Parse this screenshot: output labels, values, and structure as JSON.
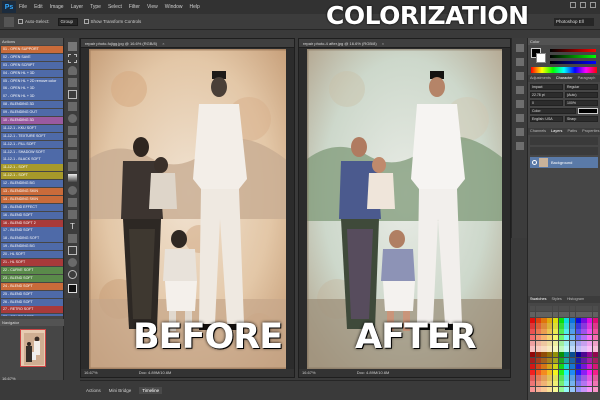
{
  "app": {
    "logo": "Ps",
    "overlay_title": "COLORIZATION"
  },
  "menu": [
    "File",
    "Edit",
    "Image",
    "Layer",
    "Type",
    "Select",
    "Filter",
    "View",
    "Window",
    "Help"
  ],
  "options_bar": {
    "auto_select_label": "Auto-Select:",
    "auto_select_value": "Group",
    "show_transform_label": "Show Transform Controls",
    "workspace": "Photoshop Ell"
  },
  "panels": {
    "actions_title": "Actions",
    "navigator_title": "Navigator",
    "navigator_zoom": "16.67%",
    "colors_title": "Color",
    "adjustments_tabs": [
      "Adjustments",
      "Character",
      "Paragraph"
    ],
    "layers_tabs": [
      "Channels",
      "Layers",
      "Paths",
      "Properties"
    ],
    "layer_name": "Background",
    "swatches_tabs": [
      "Swatches",
      "Styles",
      "Histogram"
    ],
    "char_font": "Impact",
    "char_style": "Regular",
    "char_size": "22.78 pt",
    "char_leading": "(Auto)",
    "char_tracking": "0",
    "char_scale": "100%",
    "char_color_label": "Color:",
    "char_lang": "English: USA",
    "char_aa": "Sharp"
  },
  "actions": [
    {
      "label": "01 - OPEN SUPPORT",
      "color": "#c96b3a"
    },
    {
      "label": "02 - OPEN SAVE",
      "color": "#4e6aa8"
    },
    {
      "label": "03 - OPEN SCRIPT",
      "color": "#4e6aa8"
    },
    {
      "label": "04 - OPEN HL + 3D",
      "color": "#4e6aa8"
    },
    {
      "label": "05 - OPEN HL + 2D remove color",
      "color": "#4e6aa8"
    },
    {
      "label": "06 - OPEN HL + 3D",
      "color": "#4e6aa8"
    },
    {
      "label": "07 - OPEN HL + 3D",
      "color": "#4e6aa8"
    },
    {
      "label": "08 - BLENDING 3D",
      "color": "#4e6aa8"
    },
    {
      "label": "09 - BLENDING OUT",
      "color": "#4e6aa8"
    },
    {
      "label": "10 - BLENDING 3D",
      "color": "#9a5aa0"
    },
    {
      "label": "11-12-1 - KKU SOFT",
      "color": "#4e6aa8"
    },
    {
      "label": "11-12-1 - TEXTURE SOFT",
      "color": "#4e6aa8"
    },
    {
      "label": "11-12-1 - FILL SOFT",
      "color": "#4e6aa8"
    },
    {
      "label": "11-12-1 - SHADOW SOFT",
      "color": "#4e6aa8"
    },
    {
      "label": "11-12-1 - BLACK SOFT",
      "color": "#4e6aa8"
    },
    {
      "label": "11-12-1 - SOFT",
      "color": "#a79a2a"
    },
    {
      "label": "11-12-1 - SOFT",
      "color": "#a79a2a"
    },
    {
      "label": "12 - BLENDING BG",
      "color": "#4e6aa8"
    },
    {
      "label": "13 - BLENDING SKIN",
      "color": "#c96b3a"
    },
    {
      "label": "14 - BLENDING SKIN",
      "color": "#c96b3a"
    },
    {
      "label": "15 - BLEND EFFECT",
      "color": "#4e6aa8"
    },
    {
      "label": "16 - BLEND SOFT",
      "color": "#4e6aa8"
    },
    {
      "label": "16 - BLEND SOFT 2",
      "color": "#a83a3a"
    },
    {
      "label": "17 - BLEND SOFT",
      "color": "#4e6aa8"
    },
    {
      "label": "18 - BLENDING SOFT",
      "color": "#4e6aa8"
    },
    {
      "label": "19 - BLENDING BG",
      "color": "#4e6aa8"
    },
    {
      "label": "20 - HL SOFT",
      "color": "#4e6aa8"
    },
    {
      "label": "21 - HL SOFT",
      "color": "#a83a3a"
    },
    {
      "label": "22 - CURVE SOFT",
      "color": "#5a8a4a"
    },
    {
      "label": "23 - BLEND SOFT",
      "color": "#5a8a4a"
    },
    {
      "label": "24 - BLEND SOFT",
      "color": "#c96b3a"
    },
    {
      "label": "25 - BLEND SOFT",
      "color": "#4e6aa8"
    },
    {
      "label": "26 - BLEND SOFT",
      "color": "#4e6aa8"
    },
    {
      "label": "27 - RETRO SOFT",
      "color": "#a83a3a"
    },
    {
      "label": "28 - COLOR SOFT",
      "color": "#4e6aa8"
    },
    {
      "label": "29 - COLOR 14 SOFT 3.0",
      "color": "#4e6aa8"
    },
    {
      "label": "30 - COLOR 14 SOFT 3.0 color remove",
      "color": "#4e6aa8"
    },
    {
      "label": "31 - COLOR 14 SOFT",
      "color": "#4e6aa8"
    },
    {
      "label": "32 - COLOR 14 SOFT",
      "color": "#4e6aa8"
    },
    {
      "label": "33 - COLOR 14 SOFT",
      "color": "#4e6aa8"
    },
    {
      "label": "34 - COLOR SOFT 3.0",
      "color": "#4e6aa8"
    },
    {
      "label": "35 - COLOR SOFT 3.0 sample texture",
      "color": "#4e6aa8"
    },
    {
      "label": "36 - COLOR SOFT",
      "color": "#a79a2a"
    },
    {
      "label": "jacak (casual) WARMTH",
      "color": "#4e6aa8"
    },
    {
      "label": "Tuncer plus (casual) 99%",
      "color": "#4e6aa8"
    }
  ],
  "documents": [
    {
      "tab": "repair photo-fujigg.jpg @ 16.6% (RGB/8)",
      "status_zoom": "16.67%",
      "status_doc": "Doc: 4.89M/10.6M",
      "label": "BEFORE"
    },
    {
      "tab": "repair photo-4 after.jpg @ 16.6% (RGB/8)",
      "status_zoom": "16.67%",
      "status_doc": "Doc: 4.89M/10.6M",
      "label": "AFTER"
    }
  ],
  "bottom_tabs": [
    "Mini Bridge",
    "Timeline"
  ],
  "bottom_tabs_prefix": "Actions",
  "accent_colors": {
    "ps_blue": "#31a8ff",
    "layer_selected": "#5a7aa8"
  }
}
